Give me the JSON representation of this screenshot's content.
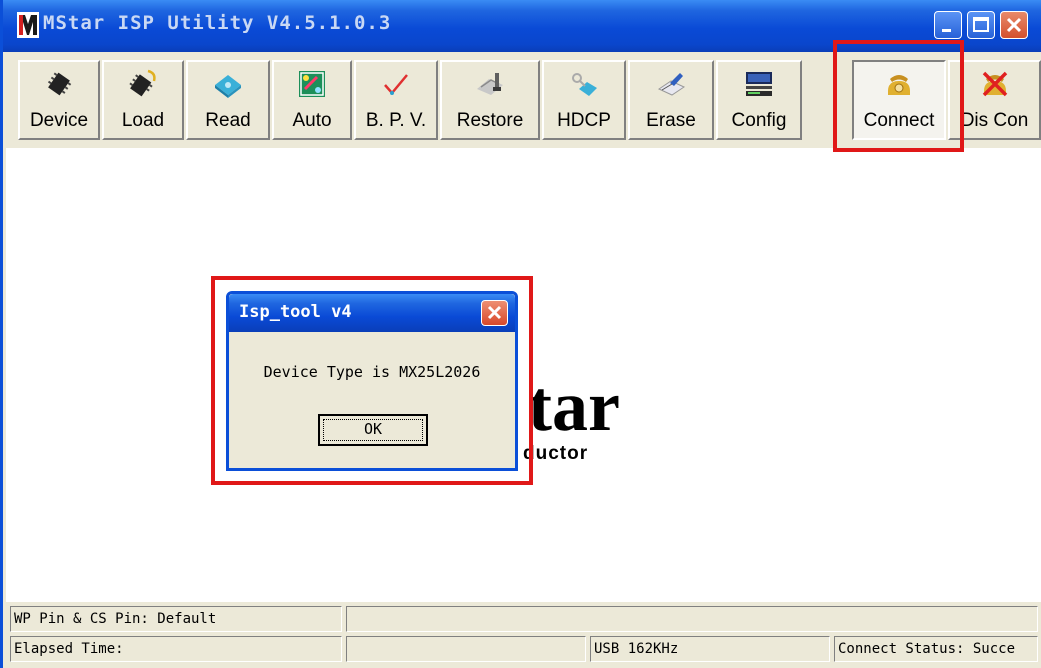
{
  "window": {
    "title": "MStar ISP Utility V4.5.1.0.3",
    "icon": "mstar-app-icon"
  },
  "toolbar": {
    "buttons": [
      {
        "label": "Device",
        "icon": "chip-icon"
      },
      {
        "label": "Load",
        "icon": "chip-load-icon"
      },
      {
        "label": "Read",
        "icon": "read-disk-icon"
      },
      {
        "label": "Auto",
        "icon": "auto-puzzle-icon"
      },
      {
        "label": "B. P. V.",
        "icon": "checkmark-icon"
      },
      {
        "label": "Restore",
        "icon": "restore-icon"
      },
      {
        "label": "HDCP",
        "icon": "hdcp-icon"
      },
      {
        "label": "Erase",
        "icon": "eraser-icon"
      },
      {
        "label": "Config",
        "icon": "computer-config-icon"
      },
      {
        "label": "Connect",
        "icon": "phone-connect-icon"
      },
      {
        "label": "Dis Con",
        "icon": "phone-disconnect-icon"
      }
    ]
  },
  "logo": {
    "text": "tar",
    "subtext": "ductor"
  },
  "dialog": {
    "title": "Isp_tool v4",
    "message": "Device Type is MX25L2026",
    "ok_label": "OK"
  },
  "status": {
    "wp_pin": "WP Pin & CS Pin: Default",
    "elapsed": "Elapsed Time:",
    "usb": "USB  162KHz",
    "connect_status": "Connect Status: Succe"
  },
  "colors": {
    "highlight": "#e01818",
    "titlebar": "#0a4ad6",
    "face": "#ece9d8"
  }
}
